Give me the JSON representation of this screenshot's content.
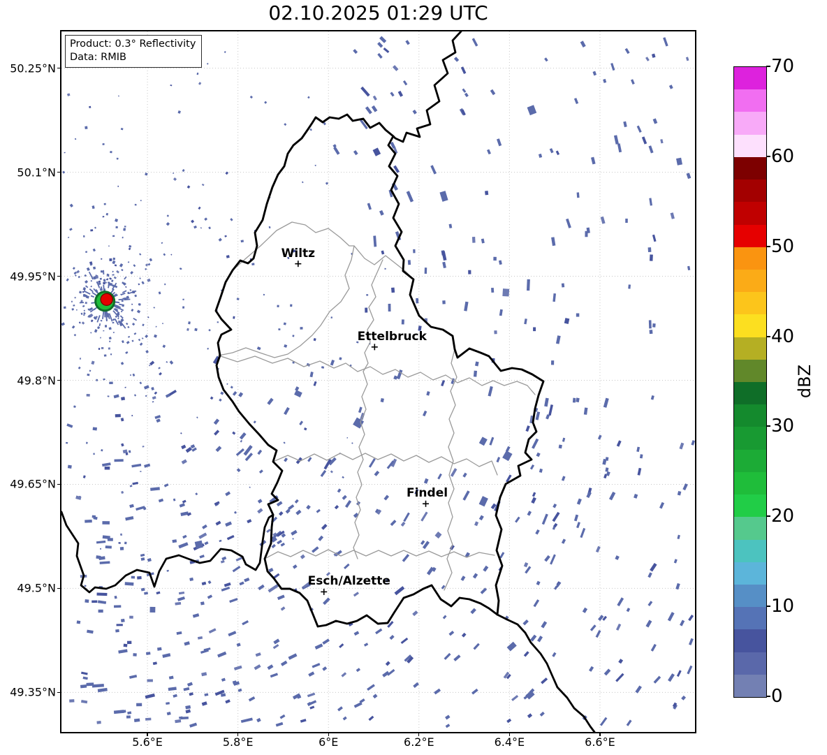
{
  "title": "02.10.2025 01:29 UTC",
  "info_box": {
    "product": "Product: 0.3° Reflectivity",
    "source": "Data: RMIB"
  },
  "axes": {
    "extent": {
      "lon_min": 5.41,
      "lon_max": 6.81,
      "lat_min": 49.293,
      "lat_max": 50.303
    },
    "lat_ticks": [
      {
        "label": "50.25°N",
        "value": 50.25
      },
      {
        "label": "50.1°N",
        "value": 50.1
      },
      {
        "label": "49.95°N",
        "value": 49.95
      },
      {
        "label": "49.8°N",
        "value": 49.8
      },
      {
        "label": "49.65°N",
        "value": 49.65
      },
      {
        "label": "49.5°N",
        "value": 49.5
      },
      {
        "label": "49.35°N",
        "value": 49.35
      }
    ],
    "lon_ticks": [
      {
        "label": "5.6°E",
        "value": 5.6
      },
      {
        "label": "5.8°E",
        "value": 5.8
      },
      {
        "label": "6°E",
        "value": 6.0
      },
      {
        "label": "6.2°E",
        "value": 6.2
      },
      {
        "label": "6.4°E",
        "value": 6.4
      },
      {
        "label": "6.6°E",
        "value": 6.6
      }
    ]
  },
  "colorbar": {
    "label": "dBZ",
    "tick_values": [
      0,
      10,
      20,
      30,
      40,
      50,
      60,
      70
    ],
    "value_range": [
      0,
      70
    ],
    "segment_step_dbz": 2.5,
    "segment_colors_bottom_to_top": [
      "#7380b3",
      "#5a68aa",
      "#47549e",
      "#5573b6",
      "#568fc6",
      "#5cb5da",
      "#4cc3bf",
      "#55c98d",
      "#21cd47",
      "#1fbd3a",
      "#1cab36",
      "#189a32",
      "#148a2d",
      "#0f6e28",
      "#61882a",
      "#b5af23",
      "#fcdf20",
      "#fcc51b",
      "#fbab17",
      "#fa9410",
      "#e60000",
      "#c00000",
      "#a30000",
      "#7d0000",
      "#fde0fd",
      "#f8aaf8",
      "#f16ef1",
      "#dd22dd"
    ]
  },
  "map": {
    "cities": [
      {
        "name": "Wiltz",
        "lon": 5.933,
        "lat": 49.968,
        "label_dx": 0
      },
      {
        "name": "Ettelbruck",
        "lon": 6.102,
        "lat": 49.848,
        "label_dx": 25
      },
      {
        "name": "Findel",
        "lon": 6.215,
        "lat": 49.622,
        "label_dx": 2
      },
      {
        "name": "Esch/Alzette",
        "lon": 5.99,
        "lat": 49.495,
        "label_dx": 36
      }
    ],
    "radar_site": {
      "lon": 5.506,
      "lat": 49.914
    },
    "colors": {
      "country_border": "#000000",
      "district_border": "#9a9a9a",
      "grid": "#c6c6c6",
      "echo": "#5b6bab",
      "echo_dark": "#47549e",
      "echo_light": "#6d7ab3",
      "radar_core": "#e60000",
      "radar_core_rim": "#7d0000",
      "radar_ring": "#1fbd3a",
      "radar_ring_rim": "#0f6e28"
    }
  },
  "chart_data": {
    "type": "map",
    "subtype": "weather-radar-reflectivity",
    "title": "02.10.2025 01:29 UTC",
    "product": "0.3° Reflectivity",
    "data_source": "RMIB",
    "unit": "dBZ",
    "scale_range_dbz": [
      0,
      70
    ],
    "geographic_extent": {
      "lon_deg_e": [
        5.41,
        6.81
      ],
      "lat_deg_n": [
        49.29,
        50.3
      ]
    },
    "gridlines": {
      "lat_deg_n": [
        49.35,
        49.5,
        49.65,
        49.8,
        49.95,
        50.1,
        50.25
      ],
      "lon_deg_e": [
        5.6,
        5.8,
        6.0,
        6.2,
        6.4,
        6.6
      ]
    },
    "labeled_places": [
      "Wiltz",
      "Ettelbruck",
      "Findel",
      "Esch/Alzette"
    ],
    "radar_site_echo": "strong point echo at radar site 5.51°E / 49.91°N: red core ~50 dBZ inside green ring ~20–35 dBZ with blue clutter spikes",
    "echo_pattern": "widespread weak echoes (0–10 dBZ, slate blue): cloud of tiny specks surrounding the radar site, plus short dashes aligned tangentially to the radar azimuth; densest south of Luxembourg, with diagonal streak bands in the northeast and southeast"
  }
}
